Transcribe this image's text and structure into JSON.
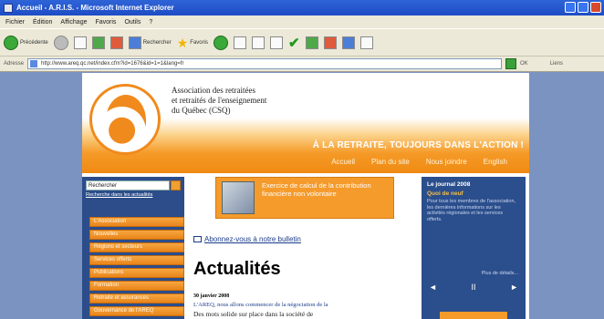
{
  "window": {
    "title": "Accueil - A.R.I.S. - Microsoft Internet Explorer"
  },
  "menu": [
    "Fichier",
    "Édition",
    "Affichage",
    "Favoris",
    "Outils",
    "?"
  ],
  "toolbar": {
    "back": "Précédente",
    "search": "Rechercher",
    "favorites": "Favoris"
  },
  "address": {
    "label": "Adresse",
    "url": "http://www.areq.qc.net/index.cfm?id=1676&id=1=1&lang=fr",
    "go": "OK",
    "links": "Liens"
  },
  "site": {
    "org_name": [
      "Association des retraitées",
      "et retraités de l'enseignement",
      "du Québec (CSQ)"
    ],
    "slogan": "À LA RETRAITE, TOUJOURS DANS L'ACTION !",
    "nav": [
      "Accueil",
      "Plan du site",
      "Nous joindre",
      "English"
    ],
    "search": {
      "value": "Rechercher",
      "advanced": "Recherche dans les actualités"
    },
    "side_menu": [
      "L'Association",
      "Nouvelles",
      "Régions et secteurs",
      "Services offerts",
      "Publications",
      "Formation",
      "Retraite et assurances",
      "Gouvernance de l'AREQ"
    ],
    "promo": "Exercice de calcul de la contribution financière non volontaire",
    "subscribe": "Abonnez-vous à notre bulletin",
    "page_title": "Actualités",
    "news": {
      "date": "30 janvier 2008",
      "line1": "L'AREQ, nous allons commencer de la négociation de la",
      "line2": "Des mots solide sur place dans la société de"
    },
    "sidebar_right": {
      "date": "Le journal 2008",
      "headline": "Quoi de neuf",
      "text": "Pour tous les membres de l'association, les dernières informations sur les activités régionales et les services offerts.",
      "more": "Plus de détails...",
      "prev": "◄",
      "pause": "II",
      "next": "►"
    }
  },
  "colors": {
    "accent": "#f59b2c",
    "navy": "#2c4d8a",
    "title_bar": "#2f64d8"
  }
}
